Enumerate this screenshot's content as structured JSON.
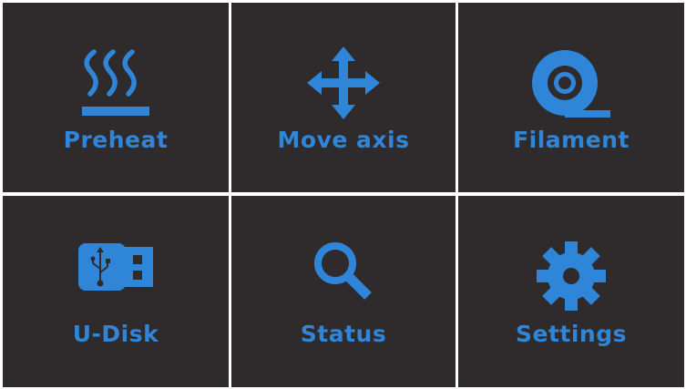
{
  "menu": {
    "items": [
      {
        "label": "Preheat",
        "icon": "preheat-icon"
      },
      {
        "label": "Move axis",
        "icon": "move-axis-icon"
      },
      {
        "label": "Filament",
        "icon": "filament-icon"
      },
      {
        "label": "U-Disk",
        "icon": "usb-icon"
      },
      {
        "label": "Status",
        "icon": "search-icon"
      },
      {
        "label": "Settings",
        "icon": "gear-icon"
      }
    ]
  },
  "colors": {
    "tile_background": "#2f2a2b",
    "accent": "#2f86d9",
    "grid_lines": "#ffffff"
  }
}
